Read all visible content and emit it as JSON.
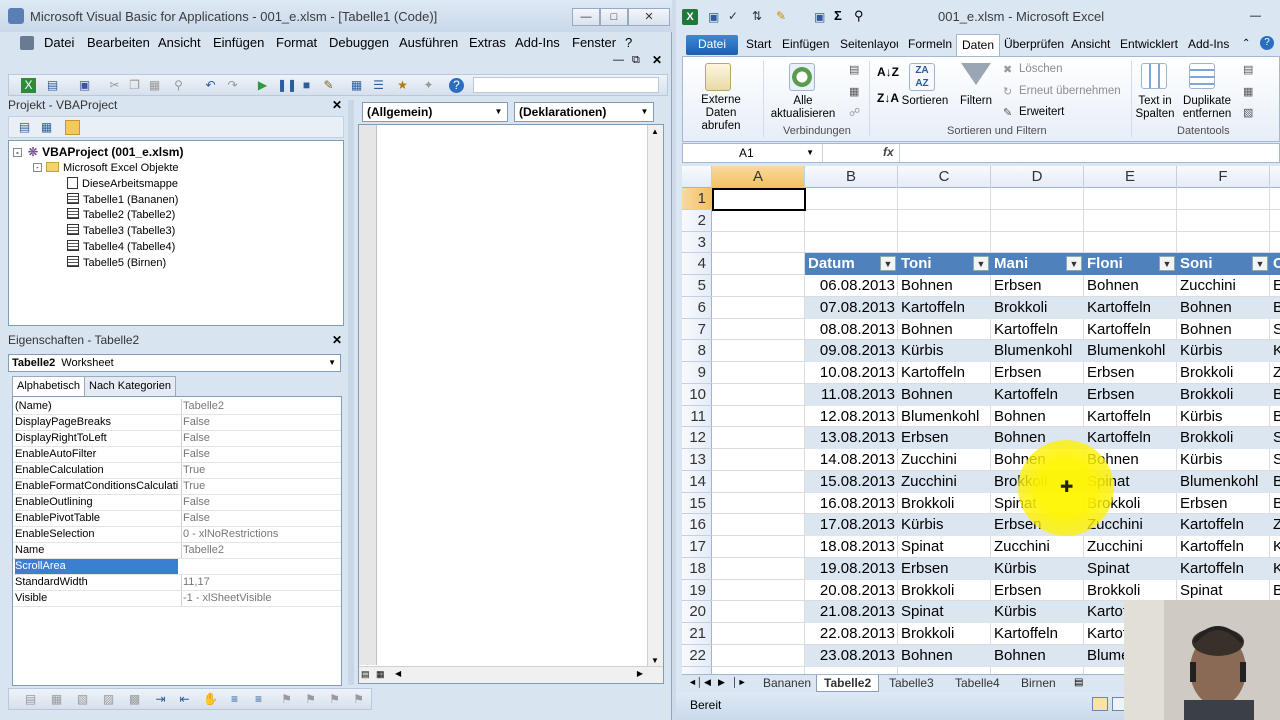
{
  "vba": {
    "title": "Microsoft Visual Basic for Applications - 001_e.xlsm - [Tabelle1 (Code)]",
    "menu": [
      "Datei",
      "Bearbeiten",
      "Ansicht",
      "Einfügen",
      "Format",
      "Debuggen",
      "Ausführen",
      "Extras",
      "Add-Ins",
      "Fenster",
      "?"
    ],
    "project": {
      "header": "Projekt - VBAProject",
      "root": "VBAProject (001_e.xlsm)",
      "folder": "Microsoft Excel Objekte",
      "items": [
        "DieseArbeitsmappe",
        "Tabelle1 (Bananen)",
        "Tabelle2 (Tabelle2)",
        "Tabelle3 (Tabelle3)",
        "Tabelle4 (Tabelle4)",
        "Tabelle5 (Birnen)"
      ]
    },
    "properties": {
      "header": "Eigenschaften - Tabelle2",
      "object_name": "Tabelle2",
      "object_type": "Worksheet",
      "tabs": [
        "Alphabetisch",
        "Nach Kategorien"
      ],
      "rows": [
        {
          "name": "(Name)",
          "value": "Tabelle2"
        },
        {
          "name": "DisplayPageBreaks",
          "value": "False"
        },
        {
          "name": "DisplayRightToLeft",
          "value": "False"
        },
        {
          "name": "EnableAutoFilter",
          "value": "False"
        },
        {
          "name": "EnableCalculation",
          "value": "True"
        },
        {
          "name": "EnableFormatConditionsCalculation",
          "value": "True"
        },
        {
          "name": "EnableOutlining",
          "value": "False"
        },
        {
          "name": "EnablePivotTable",
          "value": "False"
        },
        {
          "name": "EnableSelection",
          "value": "0 - xlNoRestrictions"
        },
        {
          "name": "Name",
          "value": "Tabelle2"
        },
        {
          "name": "ScrollArea",
          "value": ""
        },
        {
          "name": "StandardWidth",
          "value": "11,17"
        },
        {
          "name": "Visible",
          "value": "-1 - xlSheetVisible"
        }
      ]
    },
    "code": {
      "object_combo": "(Allgemein)",
      "proc_combo": "(Deklarationen)"
    }
  },
  "excel": {
    "title": "001_e.xlsm - Microsoft Excel",
    "file_tab": "Datei",
    "tabs": [
      "Start",
      "Einfügen",
      "Seitenlayout",
      "Formeln",
      "Daten",
      "Überprüfen",
      "Ansicht",
      "Entwicklert",
      "Add-Ins"
    ],
    "active_tab": "Daten",
    "ribbon": {
      "externe_daten": "Externe Daten abrufen",
      "alle_aktualisieren": "Alle aktualisieren",
      "verbindungen": "Verbindungen",
      "sortieren": "Sortieren",
      "filtern": "Filtern",
      "loeschen": "Löschen",
      "erneut": "Erneut übernehmen",
      "erweitert": "Erweitert",
      "sortieren_filtern": "Sortieren und Filtern",
      "text_in_spalten": "Text in Spalten",
      "duplikate": "Duplikate entfernen",
      "datentools": "Datentools"
    },
    "name_box": "A1",
    "fx": "fx",
    "columns": [
      "A",
      "B",
      "C",
      "D",
      "E",
      "F"
    ],
    "row_numbers": [
      "1",
      "2",
      "3",
      "4",
      "5",
      "6",
      "7",
      "8",
      "9",
      "10",
      "11",
      "12",
      "13",
      "14",
      "15",
      "16",
      "17",
      "18",
      "19",
      "20",
      "21",
      "22"
    ],
    "table_headers": [
      "Datum",
      "Toni",
      "Mani",
      "Floni",
      "Soni",
      "C"
    ],
    "table_rows": [
      [
        "06.08.2013",
        "Bohnen",
        "Erbsen",
        "Bohnen",
        "Zucchini",
        "E"
      ],
      [
        "07.08.2013",
        "Kartoffeln",
        "Brokkoli",
        "Kartoffeln",
        "Bohnen",
        "B"
      ],
      [
        "08.08.2013",
        "Bohnen",
        "Kartoffeln",
        "Kartoffeln",
        "Bohnen",
        "S"
      ],
      [
        "09.08.2013",
        "Kürbis",
        "Blumenkohl",
        "Blumenkohl",
        "Kürbis",
        "K"
      ],
      [
        "10.08.2013",
        "Kartoffeln",
        "Erbsen",
        "Erbsen",
        "Brokkoli",
        "Z"
      ],
      [
        "11.08.2013",
        "Bohnen",
        "Kartoffeln",
        "Erbsen",
        "Brokkoli",
        "B"
      ],
      [
        "12.08.2013",
        "Blumenkohl",
        "Bohnen",
        "Kartoffeln",
        "Kürbis",
        "B"
      ],
      [
        "13.08.2013",
        "Erbsen",
        "Bohnen",
        "Kartoffeln",
        "Brokkoli",
        "S"
      ],
      [
        "14.08.2013",
        "Zucchini",
        "Bohnen",
        "Bohnen",
        "Kürbis",
        "S"
      ],
      [
        "15.08.2013",
        "Zucchini",
        "Brokkoli",
        "Spinat",
        "Blumenkohl",
        "B"
      ],
      [
        "16.08.2013",
        "Brokkoli",
        "Spinat",
        "Brokkoli",
        "Erbsen",
        "B"
      ],
      [
        "17.08.2013",
        "Kürbis",
        "Erbsen",
        "Zucchini",
        "Kartoffeln",
        "Z"
      ],
      [
        "18.08.2013",
        "Spinat",
        "Zucchini",
        "Zucchini",
        "Kartoffeln",
        "K"
      ],
      [
        "19.08.2013",
        "Erbsen",
        "Kürbis",
        "Spinat",
        "Kartoffeln",
        "K"
      ],
      [
        "20.08.2013",
        "Brokkoli",
        "Erbsen",
        "Brokkoli",
        "Spinat",
        "B"
      ],
      [
        "21.08.2013",
        "Spinat",
        "Kürbis",
        "Kartof",
        "",
        ""
      ],
      [
        "22.08.2013",
        "Brokkoli",
        "Kartoffeln",
        "Kartof",
        "",
        ""
      ],
      [
        "23.08.2013",
        "Bohnen",
        "Bohnen",
        "Blume",
        "",
        ""
      ]
    ],
    "sheet_tabs": [
      "Bananen",
      "Tabelle2",
      "Tabelle3",
      "Tabelle4",
      "Birnen"
    ],
    "active_sheet": "Tabelle2",
    "status": "Bereit"
  },
  "colors": {
    "table_header": "#4f81bd",
    "band": "#dce6f1",
    "highlight": "#fff200",
    "file_tab": "#2a6ec2"
  }
}
